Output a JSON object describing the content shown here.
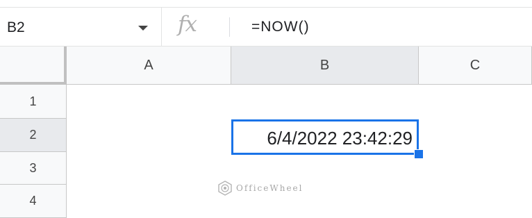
{
  "name_box": {
    "cell_ref": "B2"
  },
  "formula_bar": {
    "fx_label": "fx",
    "formula": "=NOW()"
  },
  "columns": [
    "A",
    "B",
    "C"
  ],
  "rows": [
    "1",
    "2",
    "3",
    "4"
  ],
  "selected": {
    "column": "B",
    "row": "2"
  },
  "cells": {
    "B2": "6/4/2022 23:42:29"
  },
  "watermark": {
    "text": "OfficeWheel"
  },
  "colors": {
    "selection_accent": "#1a73e8",
    "header_bg": "#f8f9fa",
    "header_selected_bg": "#e8eaed"
  }
}
